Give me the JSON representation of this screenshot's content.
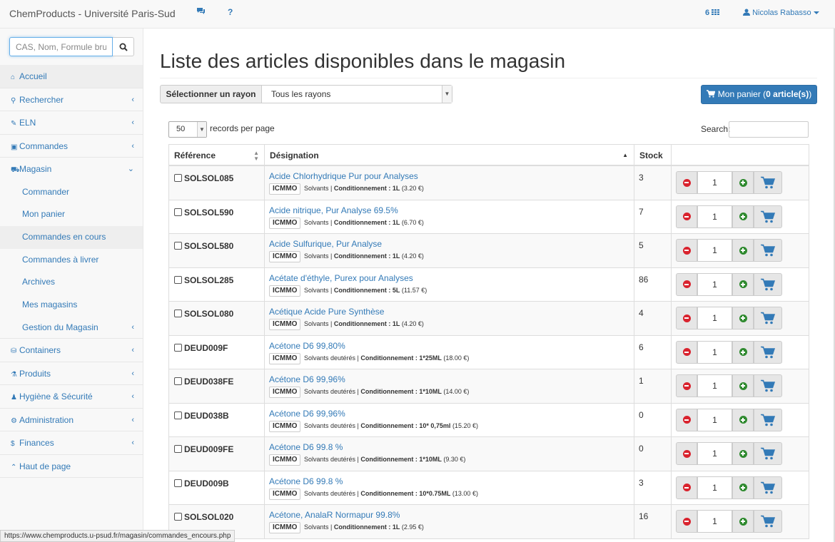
{
  "app": {
    "brand": "ChemProducts - Université Paris-Sud",
    "grid_count": "6",
    "user": "Nicolas Rabasso",
    "help_label": "?"
  },
  "sidebar": {
    "search_placeholder": "CAS, Nom, Formule brute",
    "items": [
      {
        "label": "Accueil",
        "icon": "home-icon"
      },
      {
        "label": "Rechercher",
        "icon": "search-icon"
      },
      {
        "label": "ELN",
        "icon": "edit-icon"
      },
      {
        "label": "Commandes",
        "icon": "money-icon"
      },
      {
        "label": "Magasin",
        "icon": "cart-icon"
      }
    ],
    "magasin_sub": [
      "Commander",
      "Mon panier",
      "Commandes en cours",
      "Commandes à livrer",
      "Archives",
      "Mes magasins",
      "Gestion du Magasin"
    ],
    "items_after": [
      {
        "label": "Containers",
        "icon": "database-icon"
      },
      {
        "label": "Produits",
        "icon": "flask-icon"
      },
      {
        "label": "Hygiène & Sécurité",
        "icon": "user-shield-icon"
      },
      {
        "label": "Administration",
        "icon": "cog-icon"
      },
      {
        "label": "Finances",
        "icon": "dollar-icon"
      },
      {
        "label": "Haut de page",
        "icon": "arrow-up-icon"
      }
    ]
  },
  "main": {
    "title": "Liste des articles disponibles dans le magasin",
    "rayon_label": "Sélectionner un rayon",
    "rayon_value": "Tous les rayons",
    "cart_prefix": "Mon panier (",
    "cart_count": "0 article(s)",
    "cart_suffix": ")",
    "records_value": "50",
    "records_label": "records per page",
    "search_label": "Search:",
    "columns": [
      "Référence",
      "Désignation",
      "Stock"
    ]
  },
  "rows": [
    {
      "ref": "SOLSOL085",
      "name": "Acide Chlorhydrique Pur pour Analyses",
      "supplier": "ICMMO",
      "cat": "Solvants",
      "cond_label": "Conditionnement :",
      "cond": "1L",
      "price": "(3.20 €)",
      "stock": "3",
      "qty": "1"
    },
    {
      "ref": "SOLSOL590",
      "name": "Acide nitrique, Pur Analyse 69.5%",
      "supplier": "ICMMO",
      "cat": "Solvants",
      "cond_label": "Conditionnement :",
      "cond": "1L",
      "price": "(6.70 €)",
      "stock": "7",
      "qty": "1"
    },
    {
      "ref": "SOLSOL580",
      "name": "Acide Sulfurique, Pur Analyse",
      "supplier": "ICMMO",
      "cat": "Solvants",
      "cond_label": "Conditionnement :",
      "cond": "1L",
      "price": "(4.20 €)",
      "stock": "5",
      "qty": "1"
    },
    {
      "ref": "SOLSOL285",
      "name": "Acétate d'éthyle, Purex pour Analyses",
      "supplier": "ICMMO",
      "cat": "Solvants",
      "cond_label": "Conditionnement :",
      "cond": "5L",
      "price": "(11.57 €)",
      "stock": "86",
      "qty": "1"
    },
    {
      "ref": "SOLSOL080",
      "name": "Acétique Acide Pure Synthèse",
      "supplier": "ICMMO",
      "cat": "Solvants",
      "cond_label": "Conditionnement :",
      "cond": "1L",
      "price": "(4.20 €)",
      "stock": "4",
      "qty": "1"
    },
    {
      "ref": "DEUD009F",
      "name": "Acétone D6 99,80%",
      "supplier": "ICMMO",
      "cat": "Solvants deutérés",
      "cond_label": "Conditionnement :",
      "cond": "1*25ML",
      "price": "(18.00 €)",
      "stock": "6",
      "qty": "1"
    },
    {
      "ref": "DEUD038FE",
      "name": "Acétone D6 99,96%",
      "supplier": "ICMMO",
      "cat": "Solvants deutérés",
      "cond_label": "Conditionnement :",
      "cond": "1*10ML",
      "price": "(14.00 €)",
      "stock": "1",
      "qty": "1"
    },
    {
      "ref": "DEUD038B",
      "name": "Acétone D6 99,96%",
      "supplier": "ICMMO",
      "cat": "Solvants deutérés",
      "cond_label": "Conditionnement :",
      "cond": "10* 0,75ml",
      "price": "(15.20 €)",
      "stock": "0",
      "qty": "1"
    },
    {
      "ref": "DEUD009FE",
      "name": "Acétone D6 99.8 %",
      "supplier": "ICMMO",
      "cat": "Solvants deutérés",
      "cond_label": "Conditionnement :",
      "cond": "1*10ML",
      "price": "(9.30 €)",
      "stock": "0",
      "qty": "1"
    },
    {
      "ref": "DEUD009B",
      "name": "Acétone D6 99.8 %",
      "supplier": "ICMMO",
      "cat": "Solvants deutérés",
      "cond_label": "Conditionnement :",
      "cond": "10*0.75ML",
      "price": "(13.00 €)",
      "stock": "3",
      "qty": "1"
    },
    {
      "ref": "SOLSOL020",
      "name": "Acétone, AnalaR Normapur 99.8%",
      "supplier": "ICMMO",
      "cat": "Solvants",
      "cond_label": "Conditionnement :",
      "cond": "1L",
      "price": "(2.95 €)",
      "stock": "16",
      "qty": "1"
    }
  ],
  "status_url": "https://www.chemproducts.u-psud.fr/magasin/commandes_encours.php",
  "colors": {
    "link": "#337ab7",
    "primary": "#337ab7",
    "minus": "#d9232e",
    "plus": "#2f8a2f"
  }
}
